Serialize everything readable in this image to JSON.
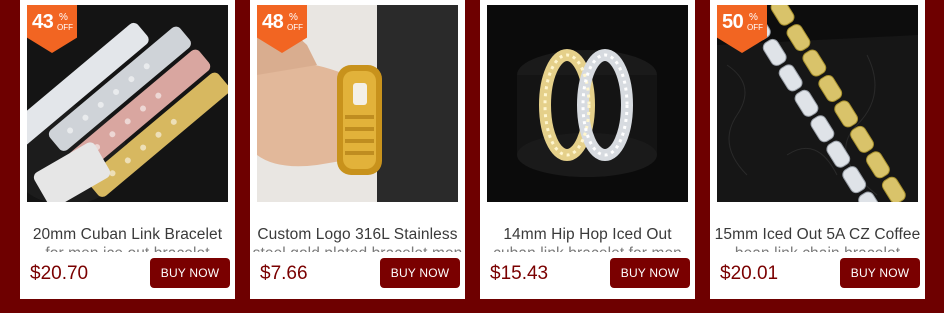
{
  "products": [
    {
      "badge": {
        "value": "43",
        "percent": "%",
        "off": "OFF"
      },
      "title": "20mm Cuban Link Bracelet",
      "subtitle": "for men ice out bracelet",
      "price": "$20.70",
      "buy_label": "BUY NOW",
      "image_icon": "iced-cuban-bracelets-photo"
    },
    {
      "badge": {
        "value": "48",
        "percent": "%",
        "off": "OFF"
      },
      "title": "Custom Logo 316L Stainless",
      "subtitle": "steel gold plated bracelet men",
      "price": "$7.66",
      "buy_label": "BUY NOW",
      "image_icon": "gold-bracelet-on-wrist-photo"
    },
    {
      "badge": null,
      "title": "14mm Hip Hop Iced Out",
      "subtitle": "cuban link bracelet for men",
      "price": "$15.43",
      "buy_label": "BUY NOW",
      "image_icon": "bracelets-on-velvet-photo"
    },
    {
      "badge": {
        "value": "50",
        "percent": "%",
        "off": "OFF"
      },
      "title": "15mm Iced Out 5A CZ Coffee",
      "subtitle": "bean link chain bracelet",
      "price": "$20.01",
      "buy_label": "BUY NOW",
      "image_icon": "coffee-bean-chain-photo"
    }
  ],
  "colors": {
    "background": "#6e0000",
    "badge": "#f26522",
    "button": "#7a0000",
    "price": "#7a0000"
  }
}
